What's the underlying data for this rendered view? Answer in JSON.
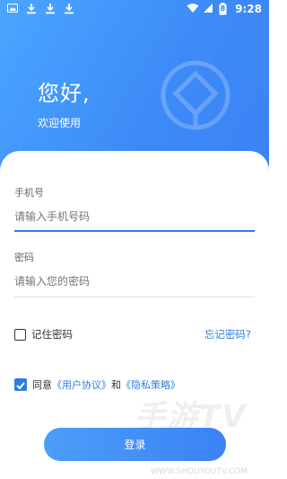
{
  "status_bar": {
    "time": "9:28",
    "battery_level": "8",
    "icons": [
      "image-icon",
      "download-icon",
      "download-icon",
      "download-icon",
      "wifi-icon",
      "signal-icon",
      "battery-icon"
    ]
  },
  "header": {
    "greeting": "您好,",
    "welcome": "欢迎使用"
  },
  "form": {
    "phone_label": "手机号",
    "phone_placeholder": "请输入手机号码",
    "password_label": "密码",
    "password_placeholder": "请输入您的密码",
    "remember_label": "记住密码",
    "remember_checked": false,
    "forgot_label": "忘记密码?",
    "agree_checked": true,
    "agree_prefix": "同意",
    "user_agreement": "《用户协议》",
    "agree_and": "和",
    "privacy_policy": "《隐私策略》",
    "login_label": "登录"
  },
  "watermark": {
    "main": "手游TV",
    "sub": "WWW.SHOUYOUTV.COM"
  },
  "colors": {
    "primary": "#2f7de1",
    "header_gradient_start": "#4aa6ff",
    "header_gradient_end": "#3b82f6"
  }
}
